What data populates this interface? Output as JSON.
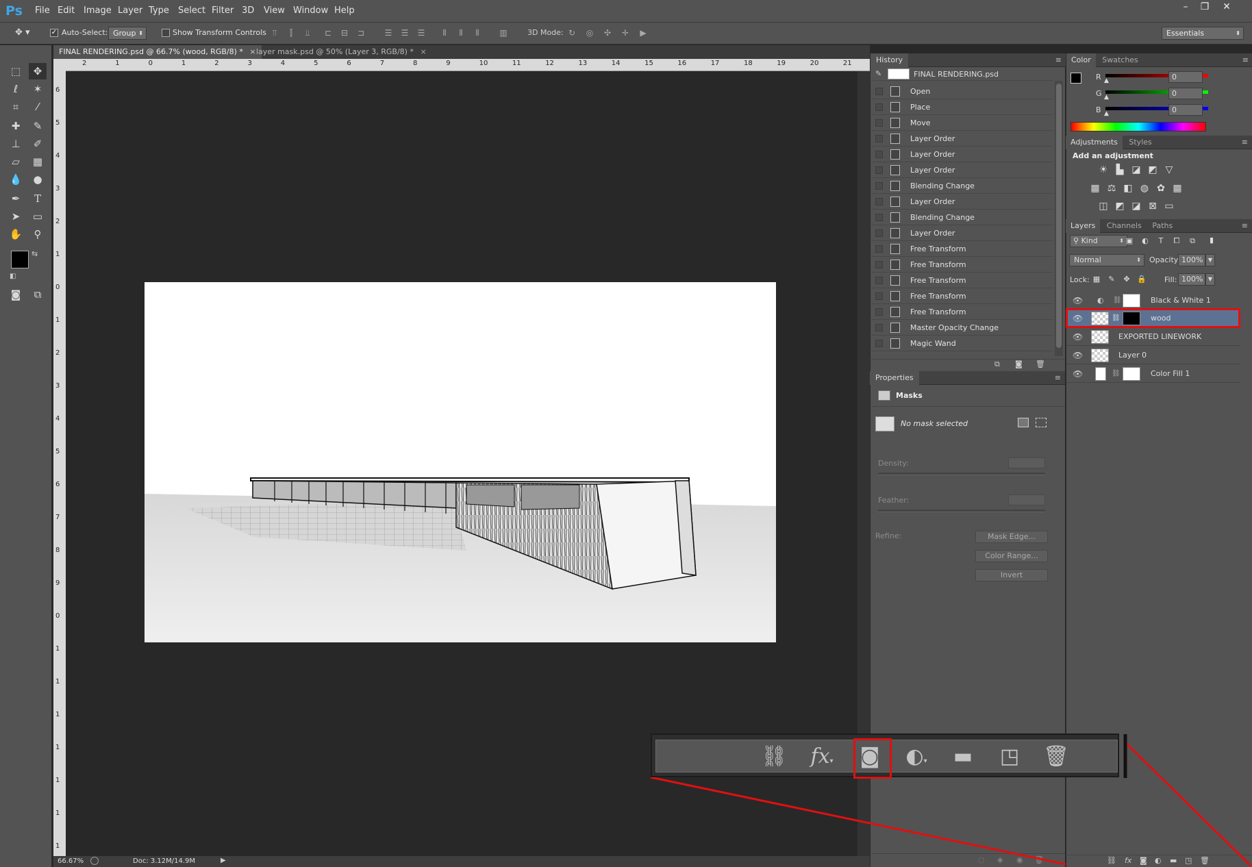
{
  "app": {
    "logo": "Ps"
  },
  "menu": [
    "File",
    "Edit",
    "Image",
    "Layer",
    "Type",
    "Select",
    "Filter",
    "3D",
    "View",
    "Window",
    "Help"
  ],
  "window_controls": {
    "minimize": "–",
    "restore": "❐",
    "close": "✕"
  },
  "options_bar": {
    "auto_select_label": "Auto-Select:",
    "auto_select_checked": true,
    "auto_select_value": "Group",
    "transform_label": "Show Transform Controls",
    "mode_label": "3D Mode:",
    "workspace": "Essentials"
  },
  "document_tabs": [
    {
      "label": "FINAL RENDERING.psd @ 66.7% (wood, RGB/8) *",
      "active": true
    },
    {
      "label": "layer mask.psd @ 50% (Layer 3, RGB/8) *",
      "active": false
    }
  ],
  "ruler": {
    "top": [
      "2",
      "1",
      "0",
      "1",
      "2",
      "3",
      "4",
      "5",
      "6",
      "7",
      "8",
      "9",
      "10",
      "11",
      "12",
      "13",
      "14",
      "15",
      "16",
      "17",
      "18",
      "19",
      "20",
      "21"
    ],
    "left": [
      "6",
      "5",
      "4",
      "3",
      "2",
      "1",
      "0",
      "1",
      "2",
      "3",
      "4",
      "5",
      "6",
      "7",
      "8",
      "9",
      "0",
      "1",
      "1",
      "1",
      "1",
      "1",
      "1",
      "1"
    ]
  },
  "status_bar": {
    "zoom": "66.67%",
    "doc": "Doc: 3.12M/14.9M"
  },
  "history": {
    "tab": "History",
    "snapshot": "FINAL RENDERING.psd",
    "items": [
      "Open",
      "Place",
      "Move",
      "Layer Order",
      "Layer Order",
      "Layer Order",
      "Blending Change",
      "Layer Order",
      "Blending Change",
      "Layer Order",
      "Free Transform",
      "Free Transform",
      "Free Transform",
      "Free Transform",
      "Free Transform",
      "Master Opacity Change",
      "Magic Wand"
    ]
  },
  "properties": {
    "tab": "Properties",
    "section": "Masks",
    "no_mask": "No mask selected",
    "density_label": "Density:",
    "feather_label": "Feather:",
    "refine_label": "Refine:",
    "buttons": [
      "Mask Edge...",
      "Color Range...",
      "Invert"
    ]
  },
  "color_panel": {
    "tabs": [
      "Color",
      "Swatches"
    ],
    "channels": [
      {
        "label": "R",
        "value": "0"
      },
      {
        "label": "G",
        "value": "0"
      },
      {
        "label": "B",
        "value": "0"
      }
    ]
  },
  "adjustments": {
    "tabs": [
      "Adjustments",
      "Styles"
    ],
    "heading": "Add an adjustment"
  },
  "layers_panel": {
    "tabs": [
      "Layers",
      "Channels",
      "Paths"
    ],
    "filter_kind": "Kind",
    "blend_mode": "Normal",
    "opacity_label": "Opacity:",
    "opacity_value": "100%",
    "lock_label": "Lock:",
    "fill_label": "Fill:",
    "fill_value": "100%",
    "layers": [
      {
        "name": "Black & White 1",
        "selected": false
      },
      {
        "name": "wood",
        "selected": true
      },
      {
        "name": "EXPORTED LINEWORK",
        "selected": false
      },
      {
        "name": "Layer 0",
        "selected": false
      },
      {
        "name": "Color Fill 1",
        "selected": false
      }
    ]
  },
  "zoom_callout": {
    "icons": [
      "link-icon",
      "fx-icon",
      "add-mask-icon",
      "adjustment-layer-icon",
      "folder-icon",
      "new-layer-icon",
      "trash-icon"
    ],
    "fx_text": "fx",
    "highlighted": "add-mask-icon"
  },
  "colors": {
    "highlight": "#e01010",
    "panel": "#535353",
    "selected_layer": "#5d7292"
  }
}
